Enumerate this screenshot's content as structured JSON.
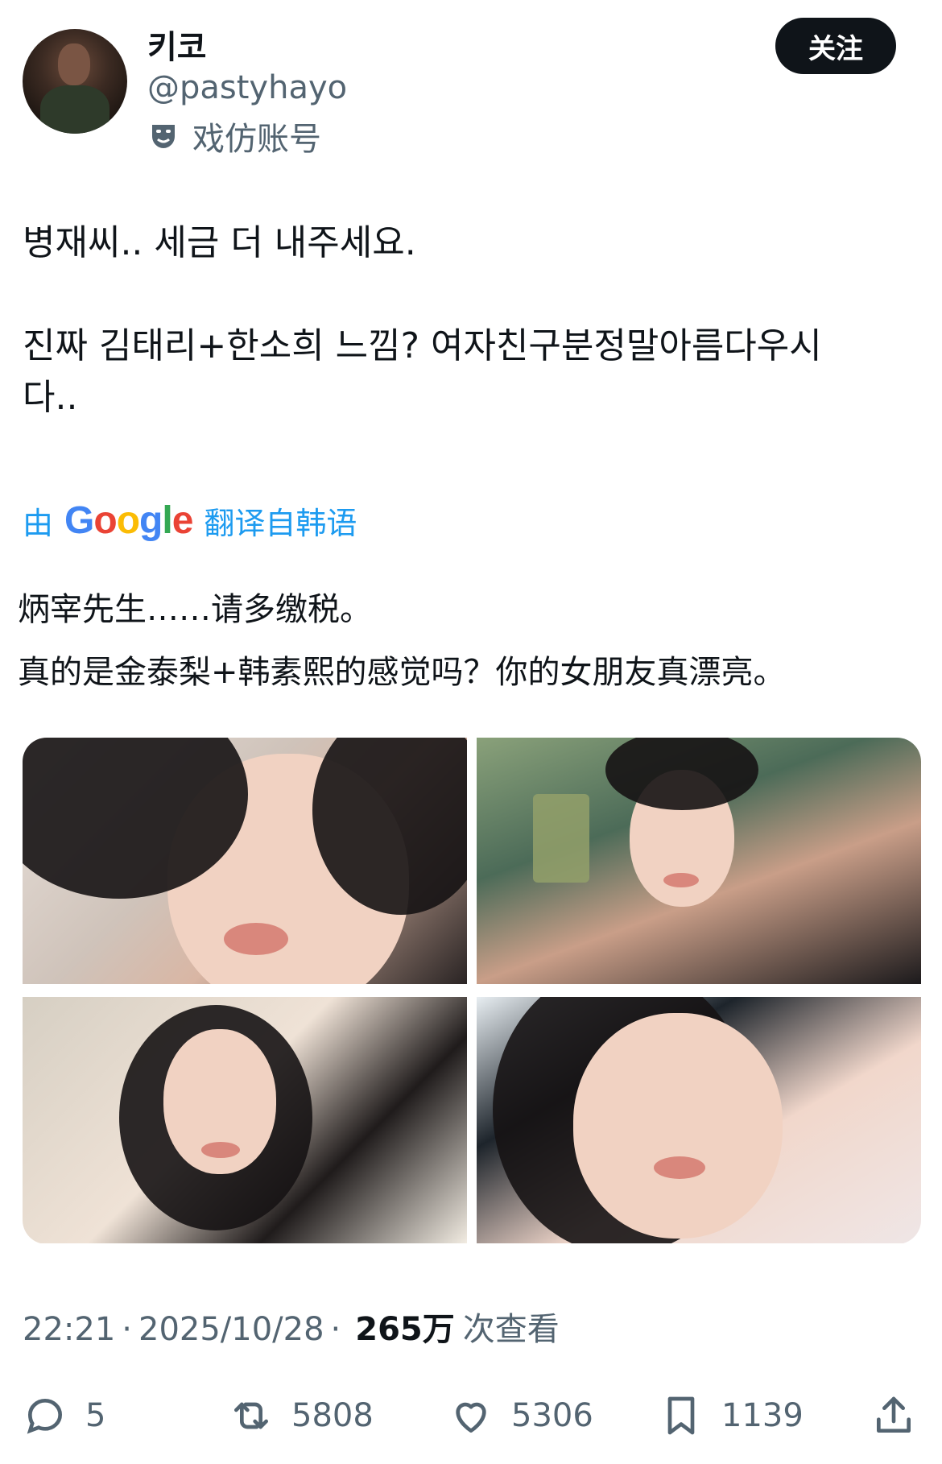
{
  "user": {
    "display_name": "키코",
    "handle": "@pastyhayo",
    "parody_label": "戏仿账号",
    "follow_label": "关注"
  },
  "tweet": {
    "text": "병재씨.. 세금 더 내주세요.\n\n진짜 김태리+한소희 느낌? 여자친구분정말아름다우시\n다..",
    "translate_prefix": "由",
    "translate_brand": "Google",
    "translate_suffix": "翻译自韩语",
    "translated_text": "炳宰先生……请多缴税。\n真的是金泰梨+韩素熙的感觉吗？你的女朋友真漂亮。"
  },
  "meta": {
    "time": "22:21",
    "date": "2025/10/28",
    "separator": "·",
    "views": "265万",
    "views_label": "次查看"
  },
  "actions": {
    "replies": "5",
    "reposts": "5808",
    "likes": "5306",
    "bookmarks": "1139"
  },
  "icons": [
    "theater-mask-icon",
    "reply-icon",
    "repost-icon",
    "like-icon",
    "bookmark-icon",
    "share-icon"
  ],
  "colors": {
    "link": "#1d9bf0",
    "muted": "#536471",
    "text": "#0f1419",
    "button_bg": "#0f1419"
  }
}
